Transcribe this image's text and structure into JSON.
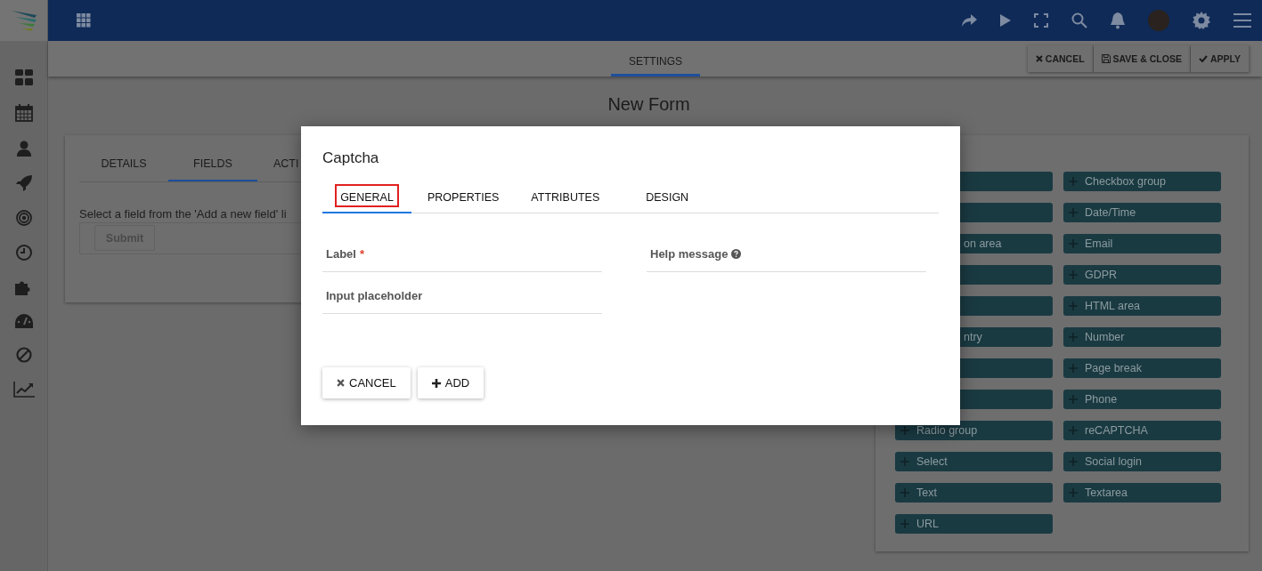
{
  "subheader": {
    "tabs": [
      {
        "label": "SETTINGS",
        "selected": true
      }
    ],
    "actions": [
      {
        "label": "CANCEL",
        "kind": "cancel"
      },
      {
        "label": "SAVE & CLOSE",
        "kind": "save"
      },
      {
        "label": "APPLY",
        "kind": "apply"
      }
    ]
  },
  "page_title": "New Form",
  "form_panel": {
    "tabs": [
      {
        "label": "DETAILS",
        "selected": false
      },
      {
        "label": "FIELDS",
        "selected": true
      },
      {
        "label": "ACTI",
        "selected": false
      }
    ],
    "hint": "Select a field from the 'Add a new field' li",
    "submit_button": "Submit"
  },
  "field_palette": {
    "items": [
      {
        "kind": "stub"
      },
      {
        "label": "Checkbox group",
        "kind": "button"
      },
      {
        "kind": "stub"
      },
      {
        "label": "Date/Time",
        "kind": "button"
      },
      {
        "label": "on area",
        "kind": "stub"
      },
      {
        "label": "Email",
        "kind": "button"
      },
      {
        "kind": "stub"
      },
      {
        "label": "GDPR",
        "kind": "button"
      },
      {
        "kind": "stub"
      },
      {
        "label": "HTML area",
        "kind": "button"
      },
      {
        "label": "ntry",
        "kind": "stub"
      },
      {
        "label": "Number",
        "kind": "button"
      },
      {
        "kind": "stub"
      },
      {
        "label": "Page break",
        "kind": "button"
      },
      {
        "kind": "stub"
      },
      {
        "label": "Phone",
        "kind": "button"
      },
      {
        "label": "Radio group",
        "kind": "button"
      },
      {
        "label": "reCAPTCHA",
        "kind": "button"
      },
      {
        "label": "Select",
        "kind": "button"
      },
      {
        "label": "Social login",
        "kind": "button"
      },
      {
        "label": "Text",
        "kind": "button"
      },
      {
        "label": "Textarea",
        "kind": "button"
      },
      {
        "label": "URL",
        "kind": "button"
      }
    ]
  },
  "dialog": {
    "title": "Captcha",
    "tabs": [
      {
        "label": "GENERAL",
        "selected": true,
        "outlined": true
      },
      {
        "label": "PROPERTIES",
        "selected": false,
        "outlined": false
      },
      {
        "label": "ATTRIBUTES",
        "selected": false,
        "outlined": false
      },
      {
        "label": "DESIGN",
        "selected": false,
        "outlined": false
      }
    ],
    "fields": [
      {
        "label": "Label",
        "required_mark": "*",
        "help_icon": false
      },
      {
        "label": "Help message",
        "help_icon": true
      },
      {
        "label": "Input placeholder",
        "help_icon": false
      }
    ],
    "buttons": [
      {
        "label": "CANCEL",
        "kind": "cancel"
      },
      {
        "label": "ADD",
        "kind": "add"
      }
    ]
  }
}
